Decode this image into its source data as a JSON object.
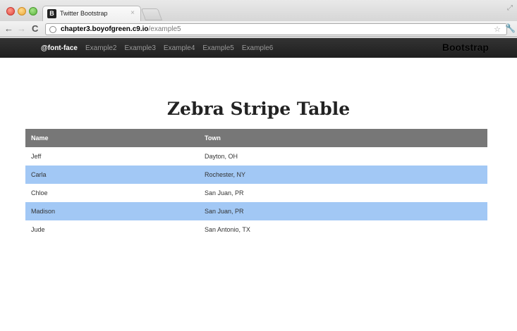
{
  "browser": {
    "tab_favicon": "B",
    "tab_title": "Twitter Bootstrap",
    "tab_close": "×",
    "url_host": "chapter3.boyofgreen.c9.io",
    "url_path": "/example5",
    "icons": [
      "back-arrow-icon",
      "forward-arrow-icon",
      "reload-icon",
      "globe-icon",
      "star-icon",
      "wrench-icon"
    ]
  },
  "navbar": {
    "items": [
      {
        "label": "@font-face",
        "active": true
      },
      {
        "label": "Example2"
      },
      {
        "label": "Example3"
      },
      {
        "label": "Example4"
      },
      {
        "label": "Example5"
      },
      {
        "label": "Example6"
      }
    ],
    "brand": "Bootstrap"
  },
  "page": {
    "title": "Zebra Stripe Table"
  },
  "table": {
    "headers": [
      "Name",
      "Town"
    ],
    "rows": [
      [
        "Jeff",
        "Dayton, OH"
      ],
      [
        "Carla",
        "Rochester, NY"
      ],
      [
        "Chloe",
        "San Juan, PR"
      ],
      [
        "Madison",
        "San Juan, PR"
      ],
      [
        "Jude",
        "San Antonio, TX"
      ]
    ],
    "stripe_color": "#a2c8f5",
    "header_color": "#777777"
  }
}
